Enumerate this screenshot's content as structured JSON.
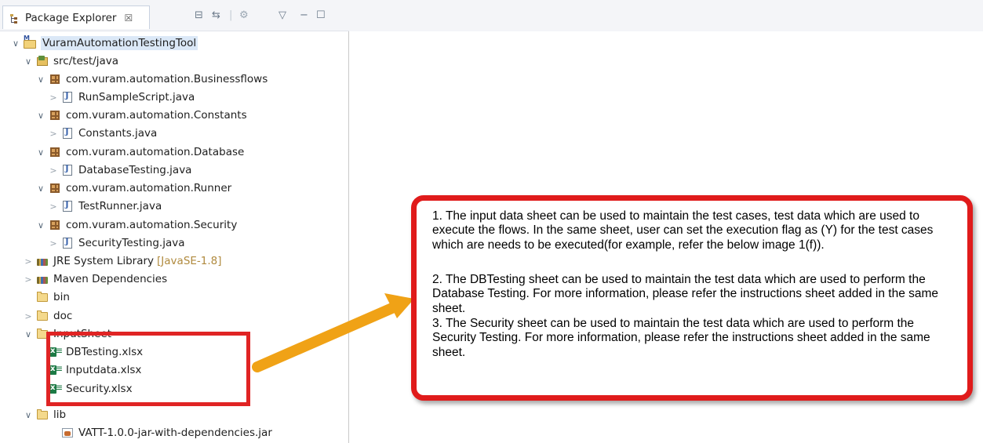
{
  "explorer": {
    "tab_title": "Package Explorer",
    "tab_close": "☒",
    "toolbar": {
      "collapse_all": "⊟",
      "link_editor": "⇆",
      "focus": "⚙",
      "view_menu": "▽",
      "minimize": "−",
      "maximize": "☐"
    },
    "tree": [
      {
        "label": "VuramAutomationTestingTool",
        "icon": "project-icon",
        "twisty": "expanded",
        "selected": true
      },
      {
        "label": "src/test/java",
        "icon": "source-folder-icon",
        "twisty": "expanded"
      },
      {
        "label": "com.vuram.automation.Businessflows",
        "icon": "package-icon",
        "twisty": "expanded"
      },
      {
        "label": "RunSampleScript.java",
        "icon": "java-file-icon",
        "twisty": "collapsed"
      },
      {
        "label": "com.vuram.automation.Constants",
        "icon": "package-icon",
        "twisty": "expanded"
      },
      {
        "label": "Constants.java",
        "icon": "java-file-icon",
        "twisty": "collapsed"
      },
      {
        "label": "com.vuram.automation.Database",
        "icon": "package-icon",
        "twisty": "expanded"
      },
      {
        "label": "DatabaseTesting.java",
        "icon": "java-file-icon",
        "twisty": "collapsed"
      },
      {
        "label": "com.vuram.automation.Runner",
        "icon": "package-icon",
        "twisty": "expanded"
      },
      {
        "label": "TestRunner.java",
        "icon": "java-file-icon",
        "twisty": "collapsed"
      },
      {
        "label": "com.vuram.automation.Security",
        "icon": "package-icon",
        "twisty": "expanded"
      },
      {
        "label": "SecurityTesting.java",
        "icon": "java-file-icon",
        "twisty": "collapsed"
      },
      {
        "label": "JRE System Library",
        "decoration": "[JavaSE-1.8]",
        "icon": "library-icon",
        "twisty": "collapsed"
      },
      {
        "label": "Maven Dependencies",
        "icon": "library-icon",
        "twisty": "collapsed"
      },
      {
        "label": "bin",
        "icon": "folder-icon",
        "twisty": "none"
      },
      {
        "label": "doc",
        "icon": "folder-icon",
        "twisty": "collapsed"
      },
      {
        "label": "InputSheet",
        "icon": "folder-icon",
        "twisty": "expanded"
      },
      {
        "label": "DBTesting.xlsx",
        "icon": "excel-file-icon",
        "twisty": "none"
      },
      {
        "label": "Inputdata.xlsx",
        "icon": "excel-file-icon",
        "twisty": "none"
      },
      {
        "label": "Security.xlsx",
        "icon": "excel-file-icon",
        "twisty": "none"
      },
      {
        "label": "lib",
        "icon": "folder-icon",
        "twisty": "expanded"
      },
      {
        "label": "VATT-1.0.0-jar-with-dependencies.jar",
        "icon": "jar-file-icon",
        "twisty": "none"
      }
    ]
  },
  "callout": {
    "paragraphs": [
      "1. The input data sheet can be used to maintain the test cases, test data which are used to execute the flows. In the same sheet, user can set the execution flag as (Y) for the test cases which are needs to be executed(for example, refer the below image 1(f)).",
      "2. The DBTesting sheet can be used to maintain the test data which are used to perform the Database Testing. For more information, please refer the instructions sheet added in the same sheet.",
      "3. The Security sheet can be used to maintain the test data which are used to perform the Security Testing. For more information, please refer the instructions sheet added in the same sheet."
    ]
  },
  "colors": {
    "highlight_red": "#e02424",
    "arrow_orange": "#f0a216"
  }
}
